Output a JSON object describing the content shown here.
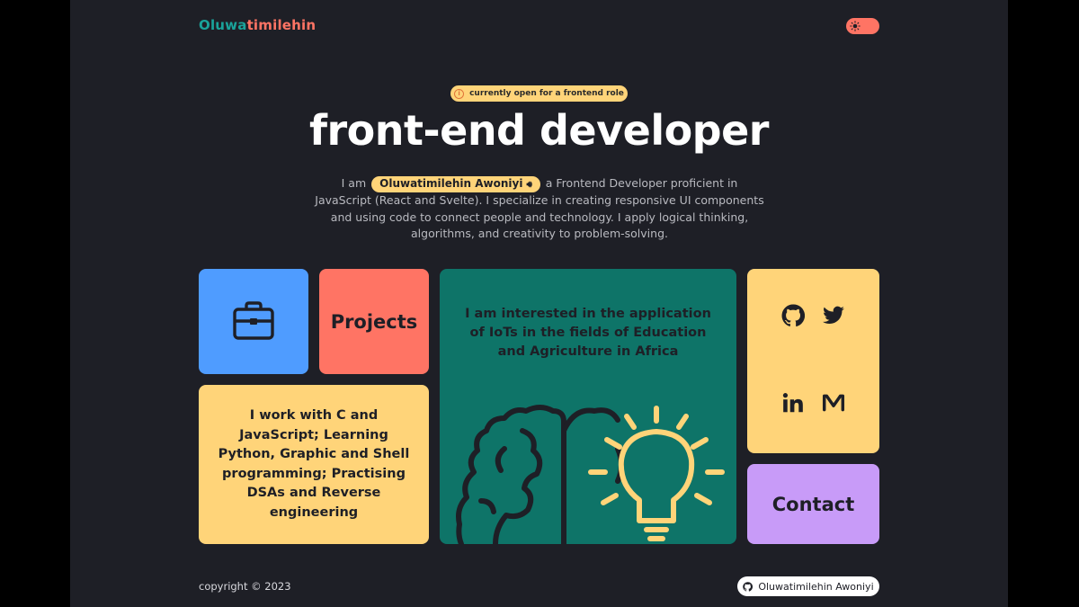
{
  "header": {
    "logo_part1": "Oluwa",
    "logo_part2": "timilehin",
    "theme_toggle_icon": "sun-icon"
  },
  "hero": {
    "badge_icon": "info-icon",
    "badge_text": "currently open for a frontend role",
    "title": "front-end developer",
    "intro_before": "I am ",
    "name": "Oluwatimilehin Awoniyi",
    "name_icon": "speaker-icon",
    "intro_after": " a Frontend Developer proficient in JavaScript (React and Svelte). I specialize in creating responsive UI components and using code to connect people and technology. I apply logical thinking, algorithms, and creativity to problem-solving."
  },
  "cards": {
    "work_icon": "briefcase-icon",
    "projects_label": "Projects",
    "skills_text": "I work with C and JavaScript; Learning Python, Graphic and Shell programming; Practising DSAs and Reverse engineering",
    "iot_text": "I am interested in the application of IoTs in the fields of Education and Agriculture in Africa",
    "iot_illustration": "brain-lightbulb-illustration",
    "social_icons": [
      "github-icon",
      "twitter-icon",
      "linkedin-icon",
      "medium-icon"
    ],
    "contact_label": "Contact"
  },
  "footer": {
    "copyright": "copyright © 2023",
    "github_name": "Oluwatimilehin Awoniyi",
    "github_icon": "github-icon"
  },
  "colors": {
    "background": "#1e1f26",
    "blue": "#4f9cff",
    "coral": "#ff7464",
    "yellow": "#ffd479",
    "teal": "#0e7468",
    "purple": "#c89bf8"
  }
}
